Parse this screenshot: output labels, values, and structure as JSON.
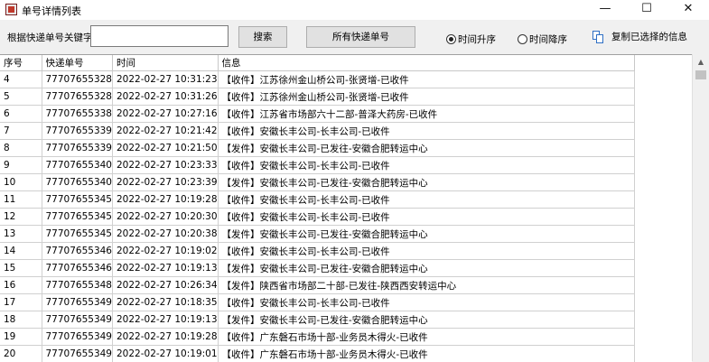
{
  "window": {
    "title": "单号详情列表",
    "minimize_glyph": "—",
    "maximize_glyph": "☐",
    "close_glyph": "✕"
  },
  "toolbar": {
    "search_label": "根据快递单号关键字：",
    "search_value": "",
    "search_button": "搜索",
    "all_button": "所有快递单号",
    "sort_asc_label": "时间升序",
    "sort_desc_label": "时间降序",
    "sort_selected": "asc",
    "copy_label": "复制已选择的信息"
  },
  "table": {
    "headers": [
      "序号",
      "快递单号",
      "时间",
      "信息"
    ],
    "rows": [
      [
        "4",
        "77707655328",
        "2022-02-27 10:31:23",
        "【收件】江苏徐州金山桥公司-张贤增-已收件"
      ],
      [
        "5",
        "77707655328",
        "2022-02-27 10:31:26",
        "【收件】江苏徐州金山桥公司-张贤增-已收件"
      ],
      [
        "6",
        "77707655338",
        "2022-02-27 10:27:16",
        "【收件】江苏省市场部六十二部-普泽大药房-已收件"
      ],
      [
        "7",
        "77707655339",
        "2022-02-27 10:21:42",
        "【收件】安徽长丰公司-长丰公司-已收件"
      ],
      [
        "8",
        "77707655339",
        "2022-02-27 10:21:50",
        "【发件】安徽长丰公司-已发往-安徽合肥转运中心"
      ],
      [
        "9",
        "77707655340",
        "2022-02-27 10:23:33",
        "【收件】安徽长丰公司-长丰公司-已收件"
      ],
      [
        "10",
        "77707655340",
        "2022-02-27 10:23:39",
        "【发件】安徽长丰公司-已发往-安徽合肥转运中心"
      ],
      [
        "11",
        "77707655345",
        "2022-02-27 10:19:28",
        "【收件】安徽长丰公司-长丰公司-已收件"
      ],
      [
        "12",
        "77707655345",
        "2022-02-27 10:20:30",
        "【收件】安徽长丰公司-长丰公司-已收件"
      ],
      [
        "13",
        "77707655345",
        "2022-02-27 10:20:38",
        "【发件】安徽长丰公司-已发往-安徽合肥转运中心"
      ],
      [
        "14",
        "77707655346",
        "2022-02-27 10:19:02",
        "【收件】安徽长丰公司-长丰公司-已收件"
      ],
      [
        "15",
        "77707655346",
        "2022-02-27 10:19:13",
        "【发件】安徽长丰公司-已发往-安徽合肥转运中心"
      ],
      [
        "16",
        "77707655348",
        "2022-02-27 10:26:34",
        "【发件】陕西省市场部二十部-已发往-陕西西安转运中心"
      ],
      [
        "17",
        "77707655349",
        "2022-02-27 10:18:35",
        "【收件】安徽长丰公司-长丰公司-已收件"
      ],
      [
        "18",
        "77707655349",
        "2022-02-27 10:19:13",
        "【发件】安徽长丰公司-已发往-安徽合肥转运中心"
      ],
      [
        "19",
        "77707655349",
        "2022-02-27 10:19:28",
        "【收件】广东磐石市场十部-业务员木得火-已收件"
      ],
      [
        "20",
        "77707655349",
        "2022-02-27 10:19:01",
        "【收件】广东磐石市场十部-业务员木得火-已收件"
      ]
    ]
  },
  "scrollbar": {
    "up_glyph": "▲"
  }
}
